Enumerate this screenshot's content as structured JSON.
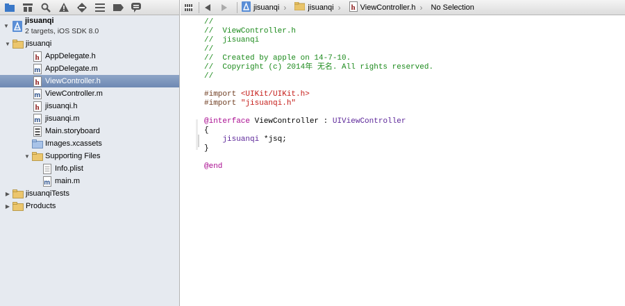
{
  "navigator": {
    "project": {
      "name": "jisuanqi",
      "subtitle": "2 targets, iOS SDK 8.0"
    },
    "items": [
      {
        "label": "jisuanqi",
        "type": "folder",
        "level": 1,
        "disclosure": "open"
      },
      {
        "label": "AppDelegate.h",
        "type": "h",
        "level": 2
      },
      {
        "label": "AppDelegate.m",
        "type": "m",
        "level": 2
      },
      {
        "label": "ViewController.h",
        "type": "h",
        "level": 2,
        "selected": true
      },
      {
        "label": "ViewController.m",
        "type": "m",
        "level": 2
      },
      {
        "label": "jisuanqi.h",
        "type": "h",
        "level": 2
      },
      {
        "label": "jisuanqi.m",
        "type": "m",
        "level": 2
      },
      {
        "label": "Main.storyboard",
        "type": "storyboard",
        "level": 2
      },
      {
        "label": "Images.xcassets",
        "type": "assets",
        "level": 2
      },
      {
        "label": "Supporting Files",
        "type": "folder",
        "level": 2,
        "disclosure": "open"
      },
      {
        "label": "Info.plist",
        "type": "plist",
        "level": 3
      },
      {
        "label": "main.m",
        "type": "m",
        "level": 3
      },
      {
        "label": "jisuanqiTests",
        "type": "folder",
        "level": 1,
        "disclosure": "closed"
      },
      {
        "label": "Products",
        "type": "folder",
        "level": 1,
        "disclosure": "closed"
      }
    ]
  },
  "jumpbar": {
    "segments": [
      "jisuanqi",
      "jisuanqi",
      "ViewController.h",
      "No Selection"
    ]
  },
  "code": {
    "lines": [
      "//",
      "//  ViewController.h",
      "//  jisuanqi",
      "//",
      "//  Created by apple on 14-7-10.",
      "//  Copyright (c) 2014年 无名. All rights reserved.",
      "//",
      "",
      "#import <UIKit/UIKit.h>",
      "#import \"jisuanqi.h\"",
      "",
      "@interface ViewController : UIViewController",
      "{",
      "    jisuanqi *jsq;",
      "}",
      "",
      "@end"
    ]
  },
  "colors": {
    "selection": "#7a93bb",
    "comment": "#1b8a1b",
    "keyword": "#aa0d91",
    "string": "#c41a16"
  }
}
